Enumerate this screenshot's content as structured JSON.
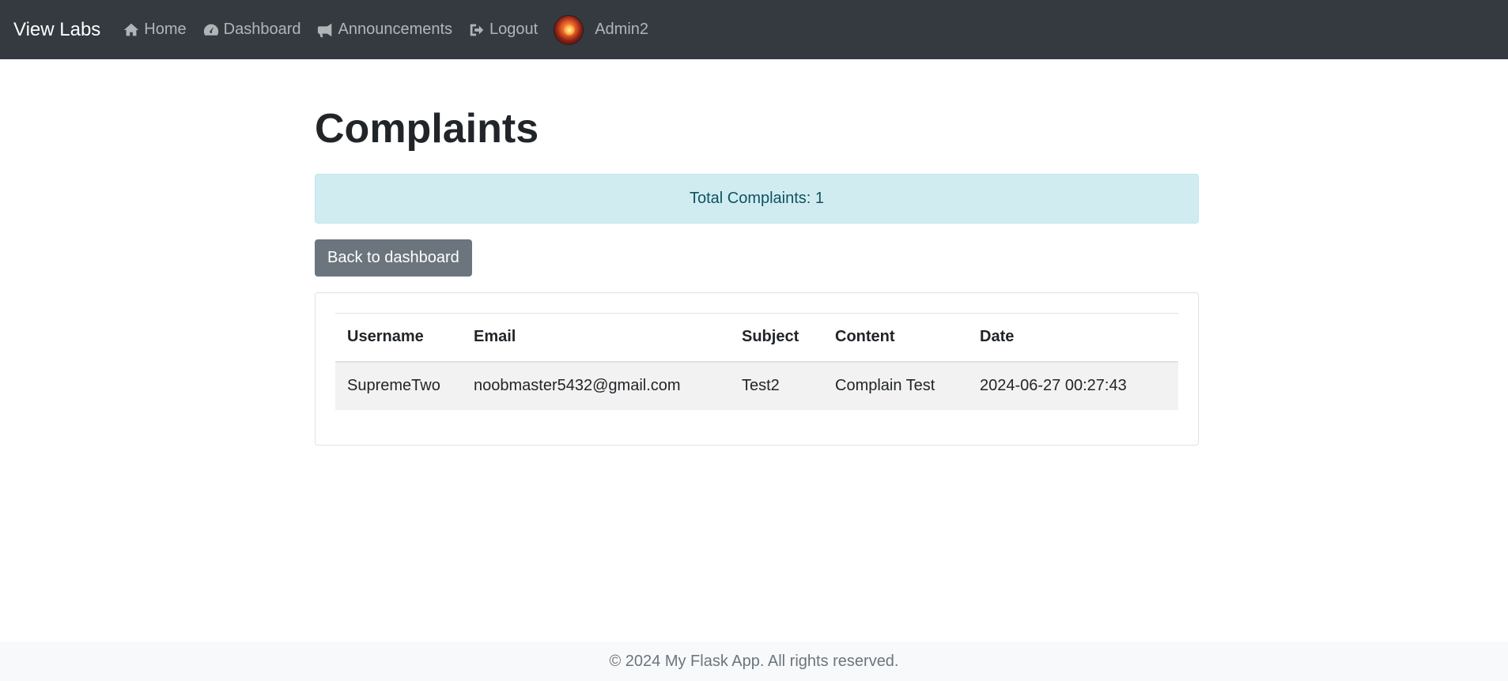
{
  "navbar": {
    "brand": "View Labs",
    "items": [
      {
        "label": "Home",
        "icon": "home-icon"
      },
      {
        "label": "Dashboard",
        "icon": "dashboard-icon"
      },
      {
        "label": "Announcements",
        "icon": "bullhorn-icon"
      },
      {
        "label": "Logout",
        "icon": "logout-icon"
      }
    ],
    "user": {
      "name": "Admin2",
      "avatar": "avatar-image"
    }
  },
  "page": {
    "title": "Complaints",
    "alert": "Total Complaints: 1",
    "back_button": "Back to dashboard"
  },
  "table": {
    "headers": [
      "Username",
      "Email",
      "Subject",
      "Content",
      "Date"
    ],
    "rows": [
      [
        "SupremeTwo",
        "noobmaster5432@gmail.com",
        "Test2",
        "Complain Test",
        "2024-06-27 00:27:43"
      ]
    ]
  },
  "footer": {
    "text": "© 2024 My Flask App. All rights reserved."
  },
  "colors": {
    "navbar_bg": "#343a40",
    "alert_bg": "#d1ecf1",
    "alert_text": "#0c5460",
    "button_bg": "#6c757d",
    "footer_bg": "#f8f9fa"
  }
}
